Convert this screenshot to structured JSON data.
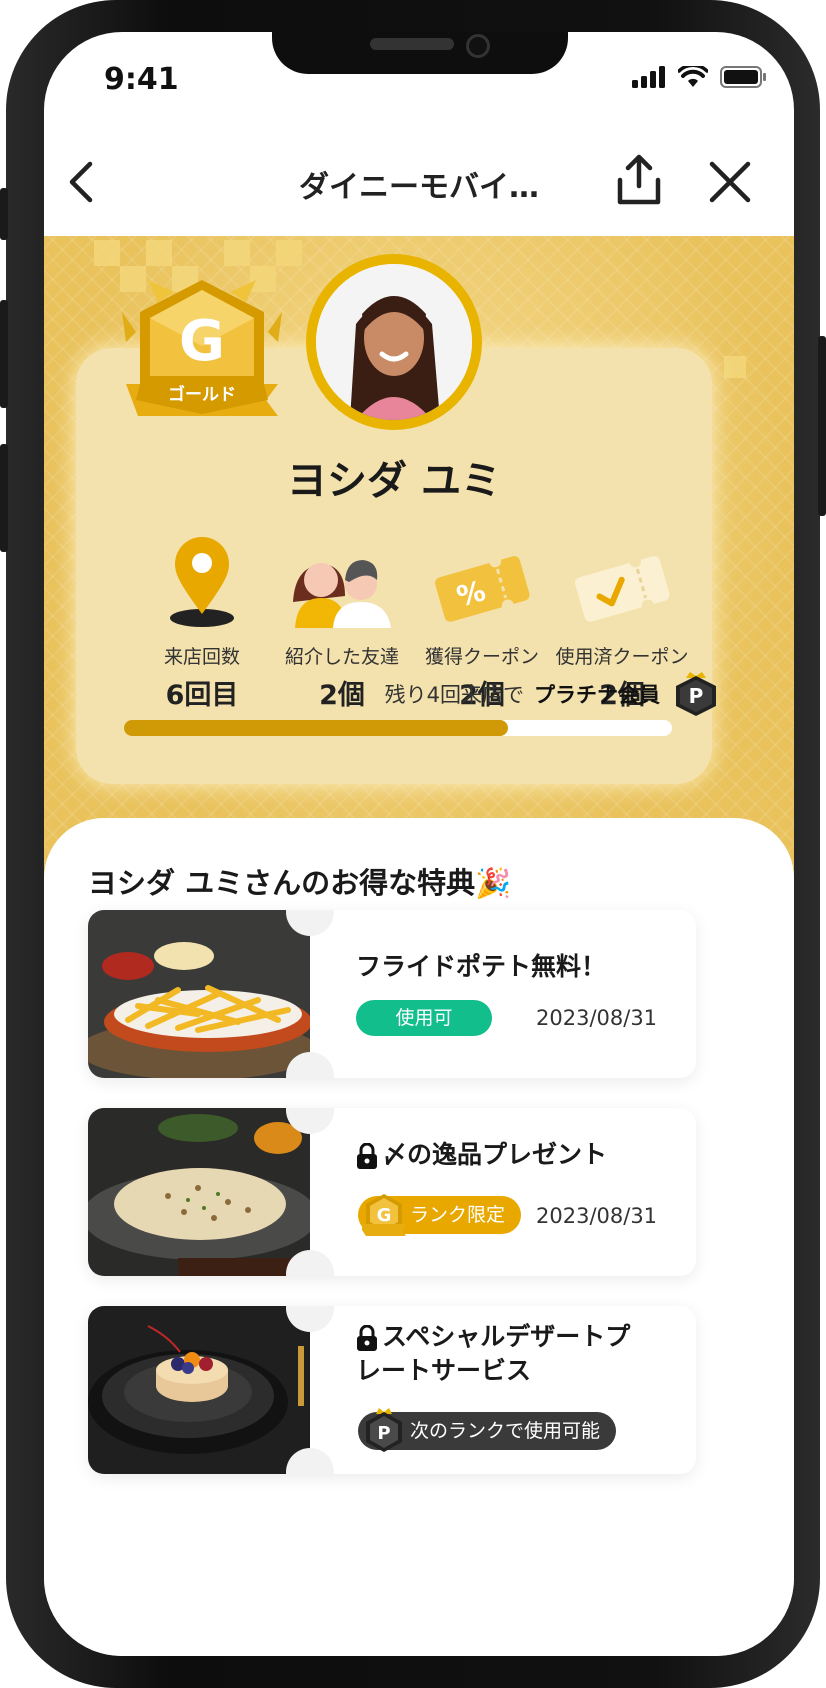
{
  "status_bar": {
    "time": "9:41"
  },
  "nav": {
    "title": "ダイニーモバイ…"
  },
  "profile": {
    "rank_badge_letter": "G",
    "rank_badge_label": "ゴールド",
    "name": "ヨシダ ユミ",
    "stats": [
      {
        "label": "来店回数",
        "value": "6回目",
        "icon": "location-pin-icon"
      },
      {
        "label": "紹介した友達",
        "value": "2個",
        "icon": "friends-icon"
      },
      {
        "label": "獲得クーポン",
        "value": "2個",
        "icon": "coupon-percent-icon"
      },
      {
        "label": "使用済クーポン",
        "value": "2個",
        "icon": "coupon-check-icon"
      }
    ],
    "progress_text": "残り4回来店で",
    "next_rank": "プラチナ会員",
    "next_rank_badge_letter": "P",
    "progress_fraction": 0.7
  },
  "benefits": {
    "title": "ヨシダ ユミさんのお得な特典🎉",
    "items": [
      {
        "title": "フライドポテト無料！",
        "status": "使用可",
        "date": "2023/08/31",
        "image": "fries-photo"
      },
      {
        "title": "〆の逸品プレゼント",
        "status": "ランク限定",
        "badge_letter": "G",
        "date": "2023/08/31",
        "image": "risotto-photo"
      },
      {
        "title_line1": "スペシャルデザートプ",
        "title_line2": "レートサービス",
        "status": "次のランクで使用可能",
        "badge_letter": "P",
        "image": "dessert-photo"
      }
    ]
  },
  "colors": {
    "gold": "#e8b400",
    "progress_fill": "#cf9a06",
    "available_green": "#12be8c",
    "dark_pill": "#3a3a3a"
  }
}
